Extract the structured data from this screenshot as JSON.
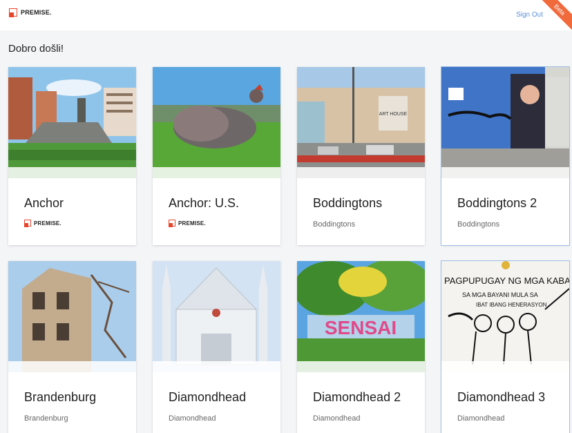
{
  "header": {
    "logo_text": "PREMISE",
    "logo_dot": ".",
    "signout_label": "Sign Out",
    "beta_label": "Beta"
  },
  "welcome": "Dobro došli!",
  "cards": [
    {
      "title": "Anchor",
      "subtitle": "",
      "brand": "PREMISE."
    },
    {
      "title": "Anchor: U.S.",
      "subtitle": "",
      "brand": "PREMISE."
    },
    {
      "title": "Boddingtons",
      "subtitle": "Boddingtons",
      "brand": ""
    },
    {
      "title": "Boddingtons 2",
      "subtitle": "Boddingtons",
      "brand": ""
    },
    {
      "title": "Brandenburg",
      "subtitle": "Brandenburg",
      "brand": ""
    },
    {
      "title": "Diamondhead",
      "subtitle": "Diamondhead",
      "brand": ""
    },
    {
      "title": "Diamondhead 2",
      "subtitle": "Diamondhead",
      "brand": ""
    },
    {
      "title": "Diamondhead 3",
      "subtitle": "Diamondhead",
      "brand": ""
    }
  ],
  "image_texts": {
    "mall_sign": "ART HOUSE",
    "sensai": "SENSAI",
    "tribute_line1": "PAGPUPUGAY NG MGA KABATAA",
    "tribute_line2": "SA MGA BAYANI MULA SA",
    "tribute_line3": "IBAT IBANG HENERASYON"
  },
  "colors": {
    "accent": "#e8452c",
    "link": "#5b8fd6",
    "beta": "#f06a3c"
  }
}
